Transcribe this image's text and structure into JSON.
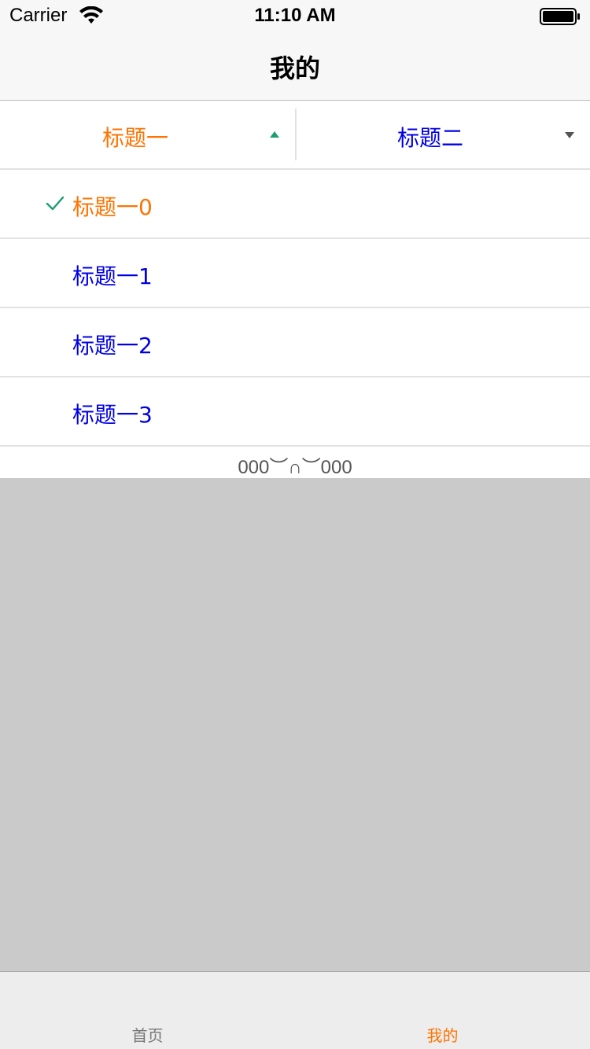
{
  "status_bar": {
    "carrier": "Carrier",
    "time": "11:10 AM",
    "icons": [
      "wifi-icon",
      "battery-icon"
    ]
  },
  "nav": {
    "title": "我的"
  },
  "dropdown_menu": {
    "columns": [
      {
        "title": "标题一",
        "state": "open",
        "arrow": "up-arrow-icon",
        "color": "#ff7300"
      },
      {
        "title": "标题二",
        "state": "closed",
        "arrow": "down-arrow-icon",
        "color": "#0000e6"
      }
    ],
    "options": [
      {
        "label": "标题一0",
        "selected": true
      },
      {
        "label": "标题一1",
        "selected": false
      },
      {
        "label": "标题一2",
        "selected": false
      },
      {
        "label": "标题一3",
        "selected": false
      }
    ],
    "footer": "000︶∩︶000"
  },
  "tab_bar": {
    "tabs": [
      {
        "label": "首页",
        "active": false
      },
      {
        "label": "我的",
        "active": true
      }
    ]
  },
  "colors": {
    "accent": "#ff7300",
    "link": "#0000e6",
    "check": "#1b9e77",
    "overlay": "#cacaca"
  }
}
